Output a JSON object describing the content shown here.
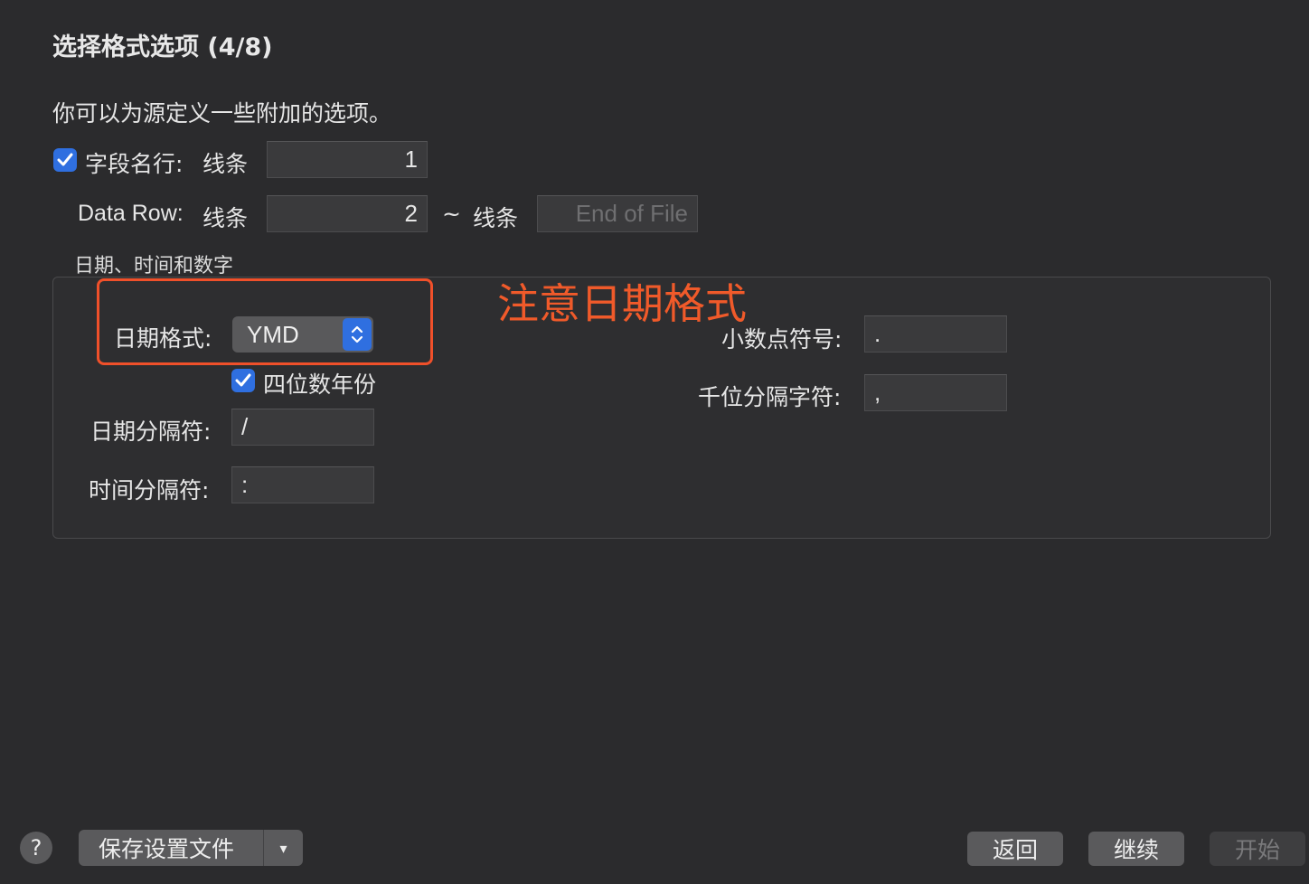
{
  "dialog": {
    "title": "选择格式选项 (4/8)",
    "description": "你可以为源定义一些附加的选项。"
  },
  "field_row": {
    "checkbox_label": "字段名行:",
    "checked": true,
    "line_label": "线条",
    "value": "1"
  },
  "data_row": {
    "label": "Data Row:",
    "line_label": "线条",
    "start_value": "2",
    "tilde": "~",
    "end_line_label": "线条",
    "end_placeholder": "End of File"
  },
  "date_group": {
    "title": "日期、时间和数字",
    "date_format_label": "日期格式:",
    "date_format_value": "YMD",
    "four_digit_year_label": "四位数年份",
    "four_digit_year_checked": true,
    "date_separator_label": "日期分隔符:",
    "date_separator_value": "/",
    "time_separator_label": "时间分隔符:",
    "time_separator_value": ":",
    "decimal_label": "小数点符号:",
    "decimal_value": ".",
    "thousands_label": "千位分隔字符:",
    "thousands_value": ","
  },
  "annotation": {
    "text": "注意日期格式",
    "color": "#f05a2a"
  },
  "footer": {
    "help": "?",
    "save_settings": "保存设置文件",
    "dropdown_arrow": "▾",
    "back": "返回",
    "continue": "继续",
    "start": "开始"
  },
  "colors": {
    "accent": "#2f6fe0",
    "background": "#2b2b2d"
  }
}
